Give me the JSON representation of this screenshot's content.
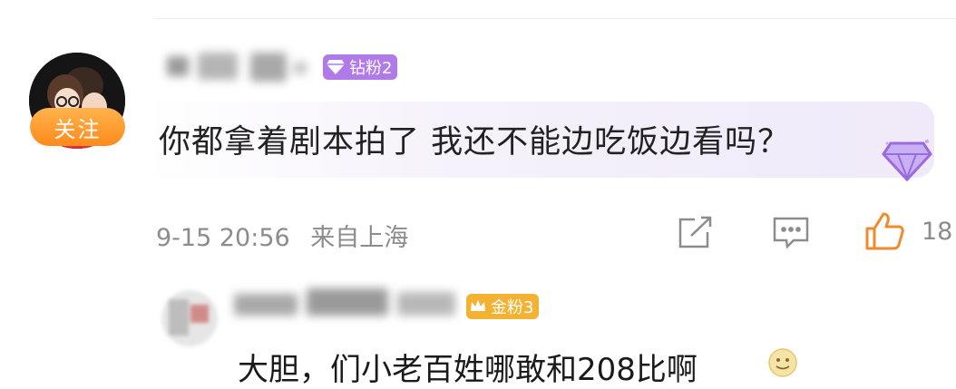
{
  "comment": {
    "follow_label": "关注",
    "fan_badge_label": "钻粉2",
    "text": "你都拿着剧本拍了 我还不能边吃饭边看吗？",
    "date": "9-15 20:56",
    "location": "来自上海",
    "likes": "18"
  },
  "reply": {
    "fan_badge_label": "金粉3",
    "text": "大胆，们小老百姓哪敢和208比啊"
  },
  "colors": {
    "diamond_badge": "#b07ae8",
    "gold_badge": "#f3b232",
    "like_orange": "#f08a2c",
    "follow_orange": "#ff9a2e"
  }
}
